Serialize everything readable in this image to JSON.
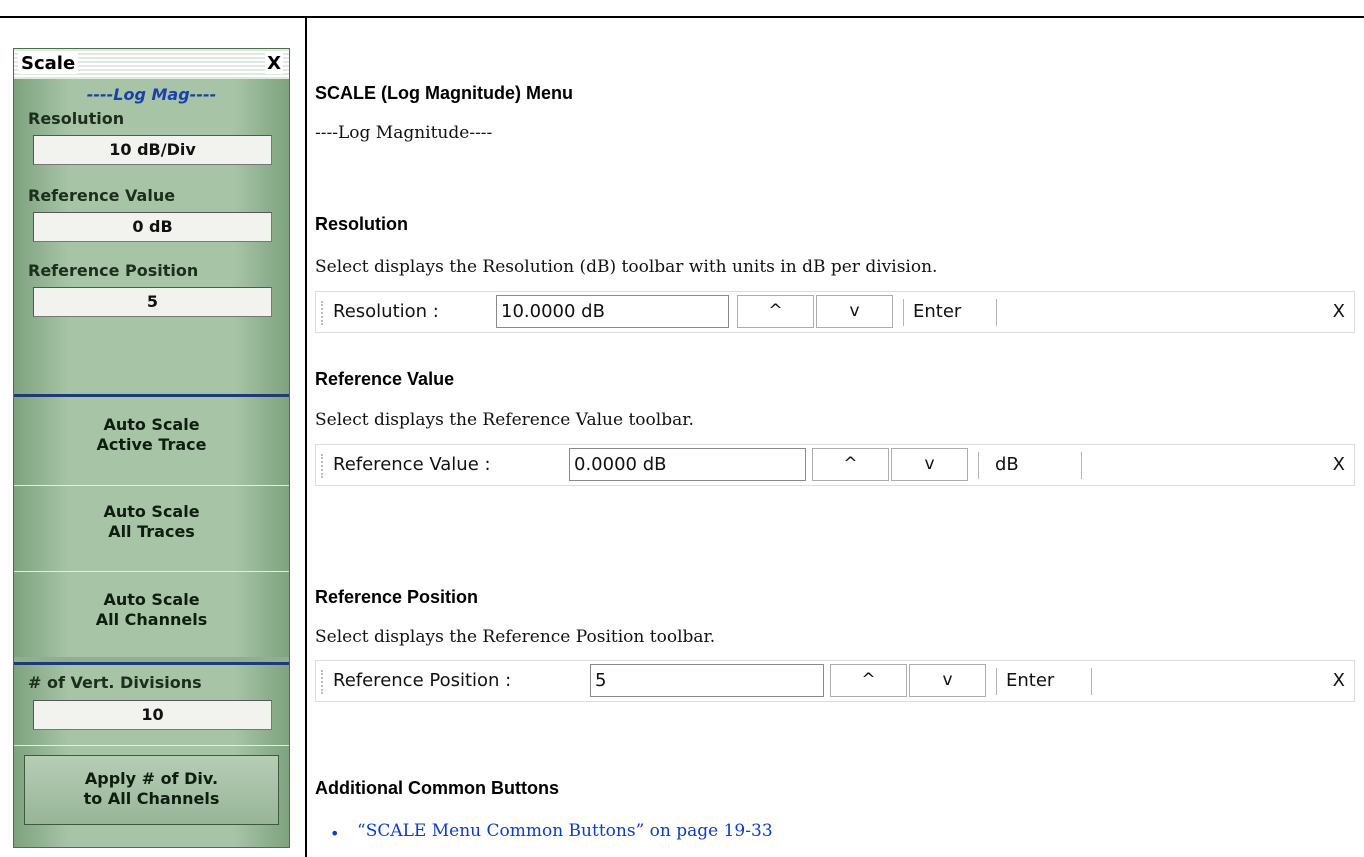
{
  "panel": {
    "title": "Scale",
    "close_label": "X",
    "subheader": "----Log Mag----",
    "fields": [
      {
        "label": "Resolution",
        "value": "10  dB/Div"
      },
      {
        "label": "Reference Value",
        "value": "0  dB"
      },
      {
        "label": "Reference Position",
        "value": "5"
      }
    ],
    "auto_buttons": [
      {
        "line1": "Auto Scale",
        "line2": "Active Trace"
      },
      {
        "line1": "Auto Scale",
        "line2": "All Traces"
      },
      {
        "line1": "Auto Scale",
        "line2": "All Channels"
      }
    ],
    "vert_div": {
      "label": "# of Vert. Divisions",
      "value": "10"
    },
    "apply": {
      "line1": "Apply # of Div.",
      "line2": "to All Channels"
    }
  },
  "doc": {
    "menu_title": "SCALE (Log Magnitude) Menu",
    "log_magnitude": "----Log Magnitude----",
    "resolution": {
      "heading": "Resolution",
      "description": "Select displays the Resolution (dB) toolbar with units in dB per division.",
      "toolbar": {
        "label": "Resolution :",
        "value": "10.0000  dB",
        "up": "^",
        "down": "v",
        "action": "Enter",
        "close": "X"
      }
    },
    "reference_value": {
      "heading": "Reference Value",
      "description": "Select displays the Reference Value toolbar.",
      "toolbar": {
        "label": "Reference Value :",
        "value": "0.0000  dB",
        "up": "^",
        "down": "v",
        "action": "dB",
        "close": "X"
      }
    },
    "reference_position": {
      "heading": "Reference Position",
      "description": "Select displays the Reference Position toolbar.",
      "toolbar": {
        "label": "Reference Position :",
        "value": "5",
        "up": "^",
        "down": "v",
        "action": "Enter",
        "close": "X"
      }
    },
    "additional": {
      "heading": "Additional Common Buttons",
      "bullet": "•",
      "link": "“SCALE Menu Common Buttons” on page 19-33"
    }
  }
}
